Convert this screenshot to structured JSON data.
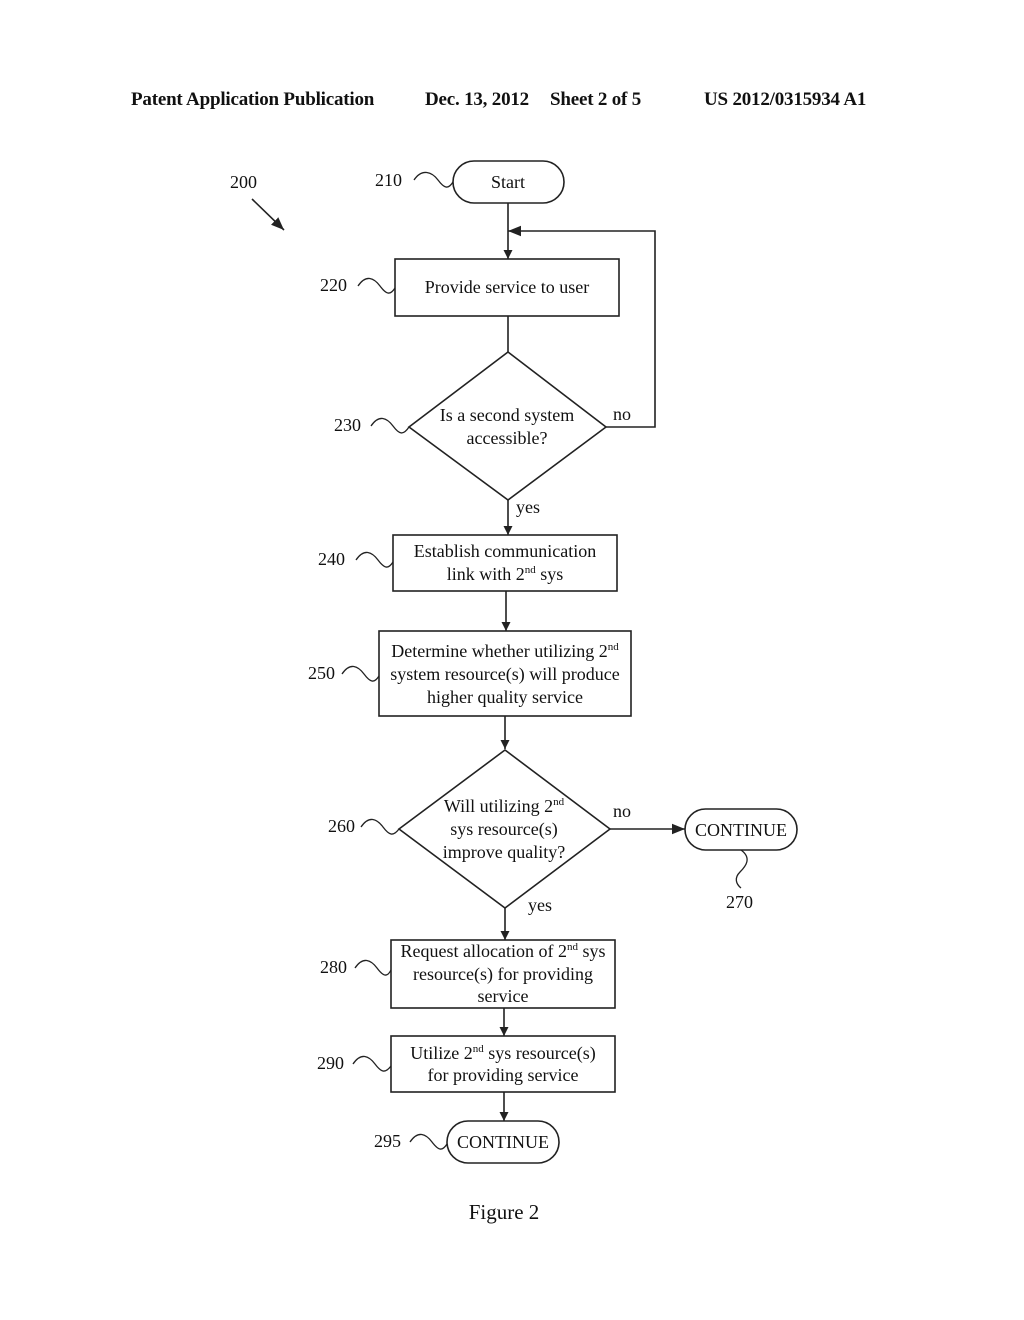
{
  "header": {
    "publication_type": "Patent Application Publication",
    "date": "Dec. 13, 2012",
    "sheet": "Sheet 2 of 5",
    "pub_number": "US 2012/0315934 A1"
  },
  "figure": {
    "ref": "200",
    "caption": "Figure 2",
    "nodes": {
      "start": {
        "ref": "210",
        "label": "Start"
      },
      "provide": {
        "ref": "220",
        "label": "Provide service to user"
      },
      "accessible": {
        "ref": "230",
        "line1": "Is a second system",
        "line2": "accessible?",
        "no_label": "no",
        "yes_label": "yes"
      },
      "establish": {
        "ref": "240",
        "line1": "Establish communication",
        "line2a": "link with 2",
        "line2sup": "nd",
        "line2b": " sys"
      },
      "determine": {
        "ref": "250",
        "line1a": "Determine whether utilizing 2",
        "line1sup": "nd",
        "line2": "system resource(s) will produce",
        "line3": "higher quality service"
      },
      "improve": {
        "ref": "260",
        "line1a": "Will utilizing 2",
        "line1sup": "nd",
        "line2": "sys resource(s)",
        "line3": "improve quality?",
        "no_label": "no",
        "yes_label": "yes"
      },
      "continue_no": {
        "ref": "270",
        "label": "CONTINUE"
      },
      "request": {
        "ref": "280",
        "line1a": "Request allocation of 2",
        "line1sup": "nd",
        "line1b": " sys",
        "line2": "resource(s) for providing",
        "line3": "service"
      },
      "utilize": {
        "ref": "290",
        "line1a": "Utilize 2",
        "line1sup": "nd",
        "line1b": " sys resource(s)",
        "line2": "for providing service"
      },
      "continue_end": {
        "ref": "295",
        "label": "CONTINUE"
      }
    }
  }
}
